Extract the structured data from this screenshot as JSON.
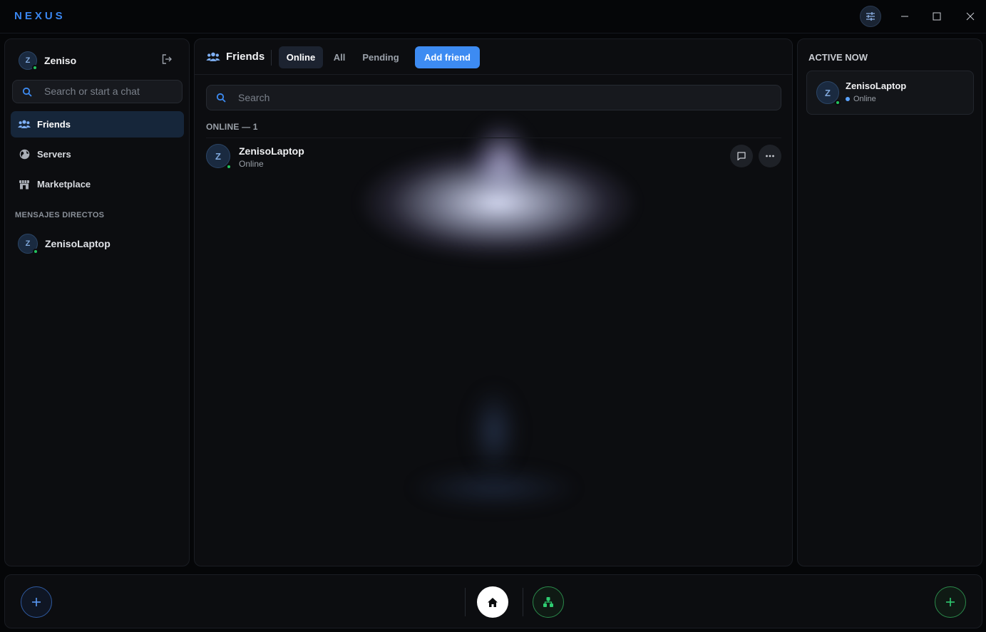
{
  "app": {
    "logo": "NEXUS"
  },
  "sidebar": {
    "user": {
      "name": "Zeniso",
      "initial": "Z"
    },
    "search_placeholder": "Search or start a chat",
    "nav": [
      {
        "label": "Friends",
        "icon": "friends-icon",
        "active": true
      },
      {
        "label": "Servers",
        "icon": "globe-icon",
        "active": false
      },
      {
        "label": "Marketplace",
        "icon": "store-icon",
        "active": false
      }
    ],
    "dm_section_label": "MENSAJES DIRECTOS",
    "dms": [
      {
        "name": "ZenisoLaptop",
        "initial": "Z"
      }
    ]
  },
  "main": {
    "title": "Friends",
    "tabs": [
      {
        "label": "Online",
        "active": true
      },
      {
        "label": "All",
        "active": false
      },
      {
        "label": "Pending",
        "active": false
      }
    ],
    "add_friend_label": "Add friend",
    "search_placeholder": "Search",
    "online_header": "ONLINE — 1",
    "friends": [
      {
        "name": "ZenisoLaptop",
        "status": "Online",
        "initial": "Z"
      }
    ]
  },
  "right": {
    "title": "ACTIVE NOW",
    "active": [
      {
        "name": "ZenisoLaptop",
        "status": "Online",
        "initial": "Z"
      }
    ]
  },
  "colors": {
    "accent": "#3d8bf2",
    "online": "#23c45e",
    "background": "#050608",
    "panel": "#0c0d10"
  }
}
